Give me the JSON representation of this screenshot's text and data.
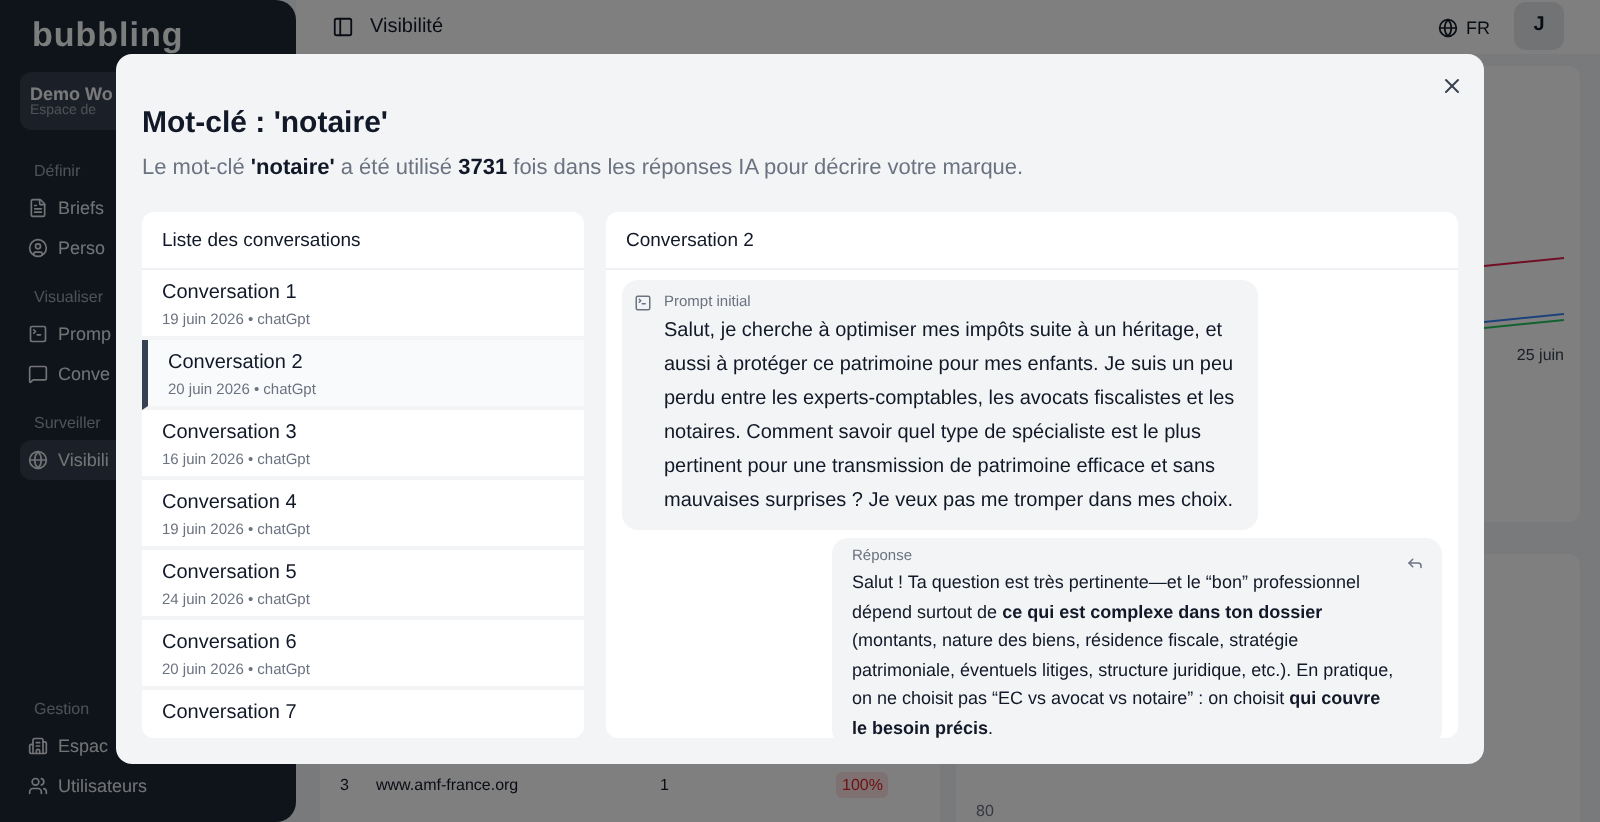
{
  "sidebar": {
    "logo": "bubbling",
    "workspace": {
      "name": "Demo Wo",
      "subtitle": "Espace de"
    },
    "sections": [
      {
        "label": "Définir",
        "items": [
          {
            "label": "Briefs",
            "selected": false
          },
          {
            "label": "Perso",
            "selected": false
          }
        ]
      },
      {
        "label": "Visualiser",
        "items": [
          {
            "label": "Promp",
            "selected": false
          },
          {
            "label": "Conve",
            "selected": false
          }
        ]
      },
      {
        "label": "Surveiller",
        "items": [
          {
            "label": "Visibili",
            "selected": true
          }
        ]
      }
    ],
    "footer": {
      "label": "Gestion",
      "items": [
        {
          "label": "Espac",
          "selected": false
        },
        {
          "label": "Utilisateurs",
          "selected": false
        }
      ]
    }
  },
  "header": {
    "title": "Visibilité",
    "language": "FR",
    "avatar": "J"
  },
  "chart_card": {
    "date_label": "25 juin"
  },
  "table": {
    "rows": [
      {
        "rank": "3",
        "site": "www.amf-france.org",
        "count": "1",
        "share": "100%"
      }
    ]
  },
  "bar_card": {
    "axis_label": "80"
  },
  "modal": {
    "title": "Mot-clé : 'notaire'",
    "subtitle": "Le mot-clé **'notaire'** a été utilisé **3731** fois dans les réponses IA pour décrire votre marque.",
    "list_title": "Liste des conversations",
    "conversations": [
      {
        "title": "Conversation 1",
        "meta": "19 juin 2026 • chatGpt",
        "selected": false
      },
      {
        "title": "Conversation 2",
        "meta": "20 juin 2026 • chatGpt",
        "selected": true
      },
      {
        "title": "Conversation 3",
        "meta": "16 juin 2026 • chatGpt",
        "selected": false
      },
      {
        "title": "Conversation 4",
        "meta": "19 juin 2026 • chatGpt",
        "selected": false
      },
      {
        "title": "Conversation 5",
        "meta": "24 juin 2026 • chatGpt",
        "selected": false
      },
      {
        "title": "Conversation 6",
        "meta": "20 juin 2026 • chatGpt",
        "selected": false
      },
      {
        "title": "Conversation 7",
        "selected": false
      }
    ],
    "detail": {
      "title": "Conversation 2",
      "prompt": {
        "label": "Prompt initial",
        "text": "Salut, je cherche à optimiser mes impôts suite à un héritage, et aussi à protéger ce patrimoine pour mes enfants. Je suis un peu perdu entre les experts-comptables, les avocats fiscalistes et les notaires. Comment savoir quel type de spécialiste est le plus pertinent pour une transmission de patrimoine efficace et sans mauvaises surprises ? Je veux pas me tromper dans mes choix."
      },
      "response": {
        "label": "Réponse",
        "text": "Salut ! Ta question est très pertinente—et le “bon” professionnel dépend surtout de **ce qui est complexe dans ton dossier** (montants, nature des biens, résidence fiscale, stratégie patrimoniale, éventuels litiges, structure juridique, etc.). En pratique, on ne choisit pas “EC vs avocat vs notaire” : on choisit **qui couvre le besoin précis**."
      }
    }
  }
}
